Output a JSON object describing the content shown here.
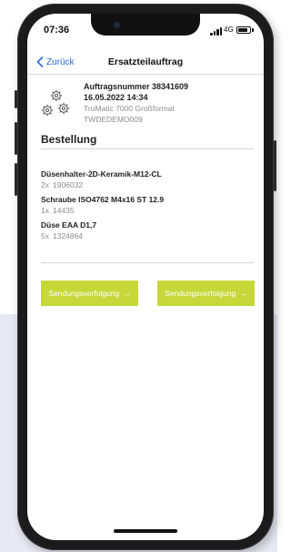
{
  "status_bar": {
    "time": "07:36",
    "network": "4G",
    "battery_level": 0.8
  },
  "nav": {
    "back_label": "Zurück",
    "title": "Ersatzteilauftrag"
  },
  "order": {
    "number_line": "Auftragsnummer  38341609",
    "date": "16.05.2022 14:34",
    "machine": "TruMatic 7000 Großformat",
    "code": "TWDEDEMO009",
    "icon": "gears-icon"
  },
  "section": {
    "title": "Bestellung"
  },
  "items": [
    {
      "name": "Düsenhalter-2D-Keramik-M12-CL",
      "qty": "2x",
      "part_no": "1906032"
    },
    {
      "name": "Schraube ISO4762 M4x16 ST 12.9",
      "qty": "1x",
      "part_no": "14435"
    },
    {
      "name": "Düse EAA D1,7",
      "qty": "5x",
      "part_no": "1324864"
    }
  ],
  "buttons": {
    "tracking_left": "Sendungsverfolgung",
    "tracking_right": "Sendungsverfolgung",
    "arrow": "→"
  },
  "colors": {
    "accent": "#c6d73a",
    "link": "#2f6bd2",
    "background_panel": "#e6e9f3"
  }
}
